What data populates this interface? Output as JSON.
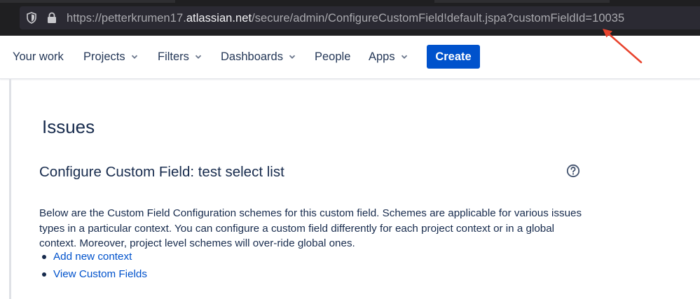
{
  "browser": {
    "url_prefix": "https://petterkrumen17.",
    "url_host": "atlassian.net",
    "url_path": "/secure/admin/ConfigureCustomField!default.jspa?customFieldId=10035",
    "icons": [
      "shield-icon",
      "lock-icon"
    ]
  },
  "nav": {
    "your_work": "Your work",
    "projects": "Projects",
    "filters": "Filters",
    "dashboards": "Dashboards",
    "people": "People",
    "apps": "Apps",
    "create": "Create",
    "chevron_icon": "chevron-down-icon"
  },
  "main": {
    "page_title": "Issues",
    "section_title": "Configure Custom Field: test select list",
    "help_icon": "question-circle-icon",
    "description": "Below are the Custom Field Configuration schemes for this custom field. Schemes are applicable for various issues types in a particular context. You can configure a custom field differently for each project context or in a global context. Moreover, project level schemes will over-ride global ones.",
    "links": {
      "add_context": "Add new context",
      "view_fields": "View Custom Fields"
    }
  },
  "colors": {
    "brand": "#0052cc",
    "text": "#172b4d",
    "annotation": "#e8432d"
  }
}
